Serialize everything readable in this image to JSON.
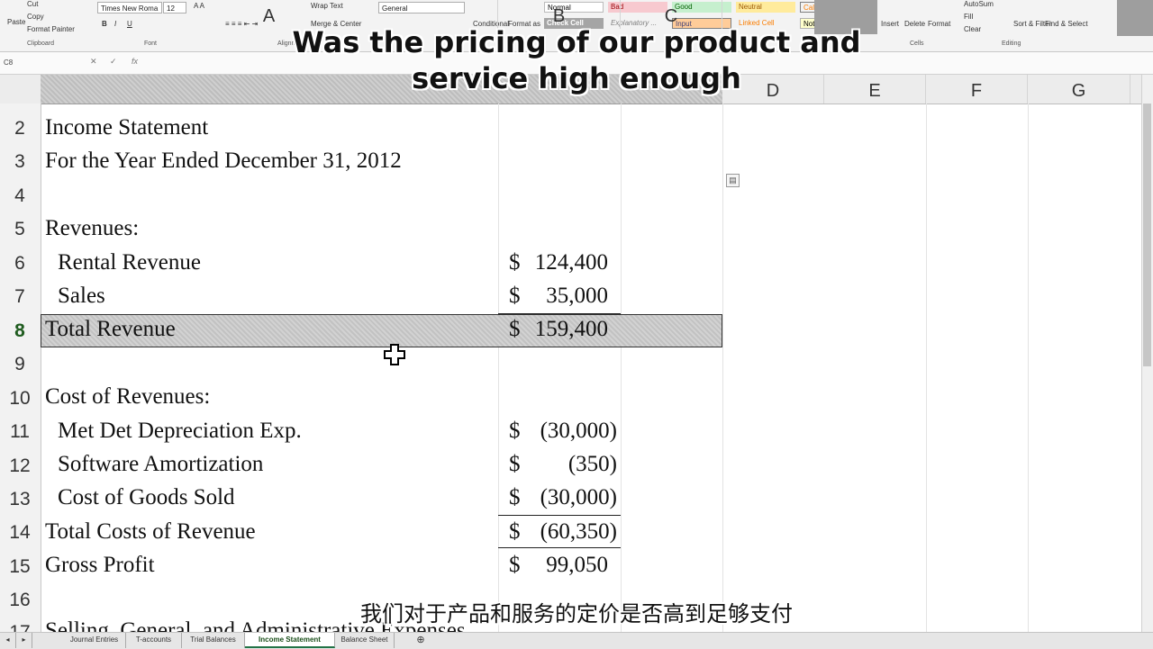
{
  "ribbon": {
    "clipboard": {
      "cut": "Cut",
      "copy": "Copy",
      "format_painter": "Format Painter",
      "paste": "Paste",
      "group": "Clipboard"
    },
    "font": {
      "name": "Times New Roma",
      "size": "12",
      "group": "Font"
    },
    "alignment": {
      "wrap_text": "Wrap Text",
      "merge": "Merge & Center",
      "group": "Alignment"
    },
    "number": {
      "format": "General"
    },
    "styles": {
      "conditional": "Conditional",
      "format_as": "Format as",
      "normal": "Normal",
      "bad": "Bad",
      "good": "Good",
      "neutral": "Neutral",
      "calculation": "Calculation",
      "check_cell": "Check Cell",
      "explanatory": "Explanatory ...",
      "input": "Input",
      "linked_cell": "Linked Cell",
      "note": "Note"
    },
    "cells": {
      "insert": "Insert",
      "delete": "Delete",
      "format": "Format",
      "group": "Cells"
    },
    "editing": {
      "autosum": "AutoSum",
      "fill": "Fill",
      "clear": "Clear",
      "sort_filter": "Sort & Filter",
      "find_select": "Find & Select",
      "group": "Editing"
    }
  },
  "formula_bar": {
    "name_box": "C8",
    "fx": "fx",
    "content": ""
  },
  "columns": [
    "A",
    "B",
    "C",
    "D",
    "E",
    "F",
    "G"
  ],
  "rows": [
    {
      "num": "2",
      "label": "Income Statement",
      "indent": 0,
      "dollar": "",
      "value": ""
    },
    {
      "num": "3",
      "label": "For the Year Ended December 31, 2012",
      "indent": 0,
      "dollar": "",
      "value": ""
    },
    {
      "num": "4",
      "label": "",
      "indent": 0,
      "dollar": "",
      "value": ""
    },
    {
      "num": "5",
      "label": "Revenues:",
      "indent": 0,
      "dollar": "",
      "value": ""
    },
    {
      "num": "6",
      "label": "Rental Revenue",
      "indent": 1,
      "dollar": "$",
      "value": "124,400"
    },
    {
      "num": "7",
      "label": "Sales",
      "indent": 1,
      "dollar": "$",
      "value": "35,000"
    },
    {
      "num": "8",
      "label": "Total Revenue",
      "indent": 0,
      "dollar": "$",
      "value": "159,400"
    },
    {
      "num": "9",
      "label": "",
      "indent": 0,
      "dollar": "",
      "value": ""
    },
    {
      "num": "10",
      "label": "Cost of Revenues:",
      "indent": 0,
      "dollar": "",
      "value": ""
    },
    {
      "num": "11",
      "label": "Met Det Depreciation Exp.",
      "indent": 1,
      "dollar": "$",
      "value": "(30,000)"
    },
    {
      "num": "12",
      "label": "Software Amortization",
      "indent": 1,
      "dollar": "$",
      "value": "(350)"
    },
    {
      "num": "13",
      "label": "Cost of Goods Sold",
      "indent": 1,
      "dollar": "$",
      "value": "(30,000)"
    },
    {
      "num": "14",
      "label": "Total Costs of Revenue",
      "indent": 0,
      "dollar": "$",
      "value": "(60,350)"
    },
    {
      "num": "15",
      "label": "Gross Profit",
      "indent": 0,
      "dollar": "$",
      "value": "99,050"
    },
    {
      "num": "16",
      "label": "",
      "indent": 0,
      "dollar": "",
      "value": ""
    },
    {
      "num": "17",
      "label": "Selling, General, and Administrative Expenses",
      "indent": 0,
      "dollar": "",
      "value": ""
    }
  ],
  "subtitles": {
    "english_line1": "Was the pricing of our product and",
    "english_line2": "service high enough",
    "chinese": "我们对于产品和服务的定价是否高到足够支付"
  },
  "sheet_tabs": [
    "Journal Entries",
    "T-accounts",
    "Trial Balances",
    "Income Statement",
    "Balance Sheet"
  ],
  "active_tab": "Income Statement",
  "add_sheet": "⊕"
}
